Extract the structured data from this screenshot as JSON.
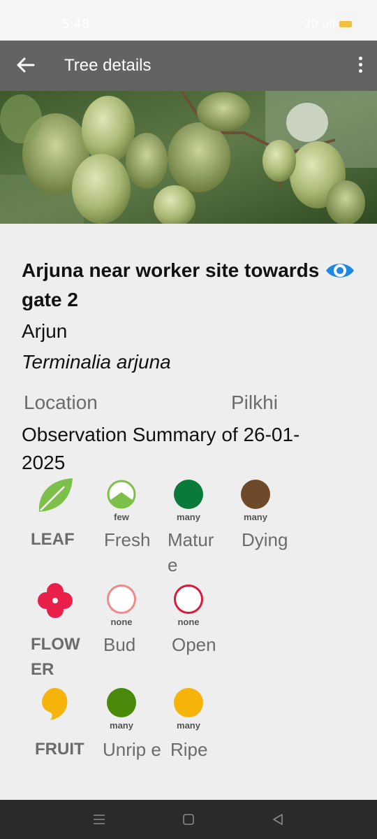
{
  "status_bar": {
    "time": "5:48",
    "signal": "20 ull"
  },
  "app_bar": {
    "title": "Tree details"
  },
  "tree": {
    "name": "Arjuna near worker site towards gate 2",
    "common_name": "Arjun",
    "scientific_name": "Terminalia arjuna",
    "location_label": "Location",
    "location_value": "Pilkhi",
    "observation_summary": "Observation Summary of 26-01-2025"
  },
  "phenology": {
    "leaf": {
      "label": "LEAF",
      "stages": [
        {
          "name": "Fresh",
          "count": "few"
        },
        {
          "name": "Matur e",
          "count": "many"
        },
        {
          "name": "Dying",
          "count": "many"
        }
      ]
    },
    "flower": {
      "label": "FLOW ER",
      "stages": [
        {
          "name": "Bud",
          "count": "none"
        },
        {
          "name": "Open",
          "count": "none"
        }
      ]
    },
    "fruit": {
      "label": "FRUIT",
      "stages": [
        {
          "name": "Unrip e",
          "count": "many"
        },
        {
          "name": "Ripe",
          "count": "many"
        }
      ]
    }
  },
  "colors": {
    "app_bar": "#636363",
    "leaf_icon": "#7cc04a",
    "mature": "#0a7a3a",
    "dying": "#6e4a2a",
    "flower_icon": "#e8204a",
    "bud_ring": "#f08a8a",
    "open_ring": "#d81b3c",
    "unripe": "#4a8a0a",
    "ripe": "#f6b40a",
    "eye": "#1e88e5"
  }
}
